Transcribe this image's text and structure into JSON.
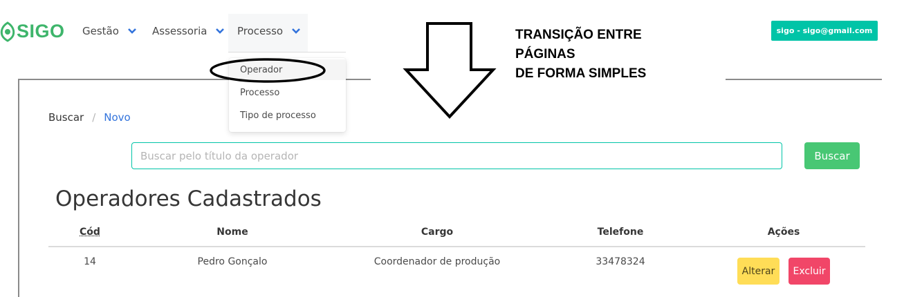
{
  "navbar": {
    "brand": "SIGO",
    "items": [
      {
        "label": "Gestão"
      },
      {
        "label": "Assessoria"
      },
      {
        "label": "Processo"
      }
    ],
    "user_button": "sigo - sigo@gmail.com",
    "accent_color": "#00c4a7",
    "brand_color": "#3eb56b"
  },
  "dropdown": {
    "items": [
      {
        "label": "Operador"
      },
      {
        "label": "Processo"
      },
      {
        "label": "Tipo de processo"
      }
    ]
  },
  "annotation": {
    "lines": [
      "TRANSIÇÃO ENTRE",
      "PÁGINAS",
      "DE FORMA SIMPLES"
    ]
  },
  "breadcrumb": {
    "items": [
      "Buscar",
      "Novo"
    ],
    "separator": "/"
  },
  "search": {
    "placeholder": "Buscar pelo título da operador",
    "value": "",
    "button": "Buscar"
  },
  "page_title": "Operadores Cadastrados",
  "table": {
    "columns": [
      "Cód",
      "Nome",
      "Cargo",
      "Telefone",
      "Ações"
    ],
    "rows": [
      {
        "cod": "14",
        "nome": "Pedro Gonçalo",
        "cargo": "Coordenador de produção",
        "telefone": "33478324"
      }
    ],
    "actions": {
      "edit": "Alterar",
      "delete": "Excluir"
    }
  }
}
